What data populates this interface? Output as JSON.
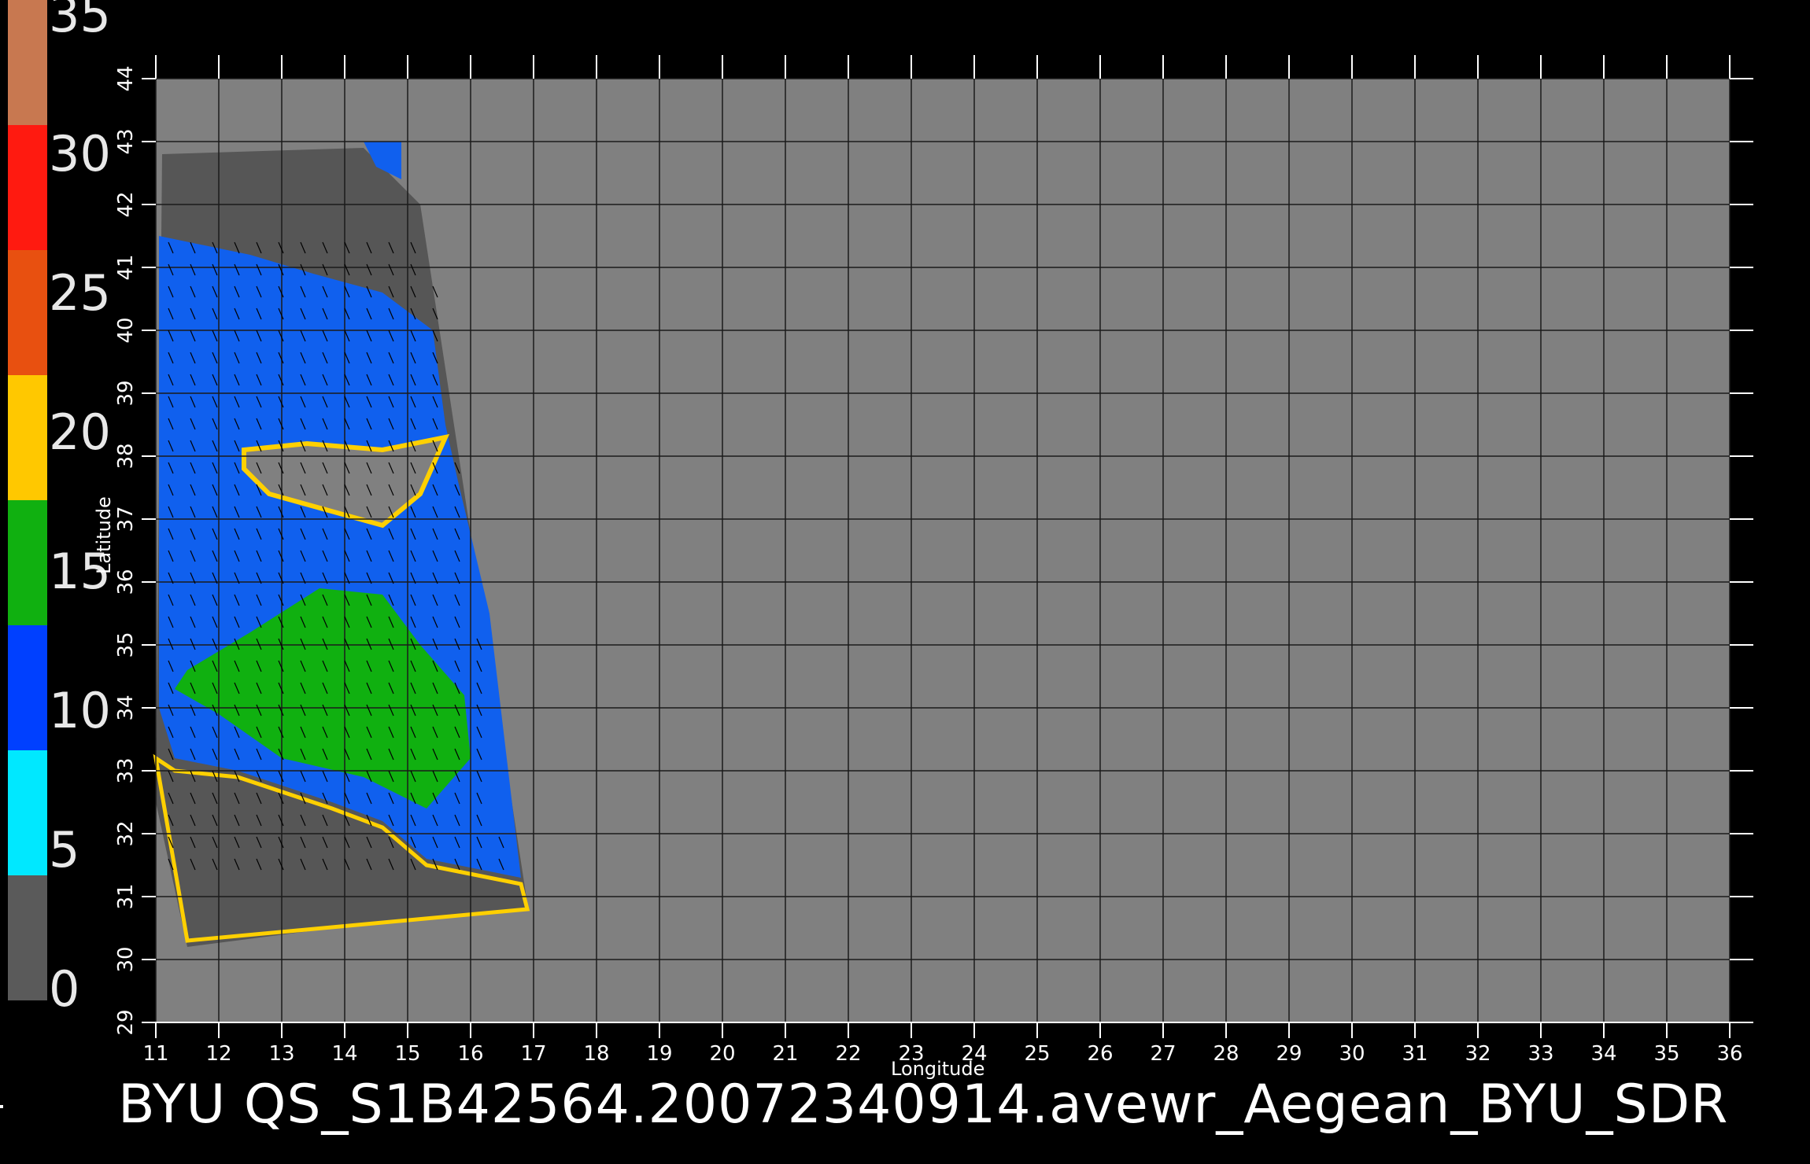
{
  "colorbar": {
    "labels": [
      "35",
      "30",
      "25",
      "20",
      "15",
      "10",
      "5",
      "0"
    ],
    "segments": [
      {
        "color": "#c87850"
      },
      {
        "color": "#ff1a10"
      },
      {
        "color": "#e85010"
      },
      {
        "color": "#ffc800"
      },
      {
        "color": "#10b010"
      },
      {
        "color": "#0040ff"
      },
      {
        "color": "#00e8ff"
      },
      {
        "color": "#5a5a5a"
      }
    ]
  },
  "axes": {
    "x_title": "Longitude",
    "y_title": "Latitude",
    "x_ticks": [
      "11",
      "12",
      "13",
      "14",
      "15",
      "16",
      "17",
      "18",
      "19",
      "20",
      "21",
      "22",
      "23",
      "24",
      "25",
      "26",
      "27",
      "28",
      "29",
      "30",
      "31",
      "32",
      "33",
      "34",
      "35",
      "36"
    ],
    "y_ticks": [
      "29",
      "30",
      "31",
      "32",
      "33",
      "34",
      "35",
      "36",
      "37",
      "38",
      "39",
      "40",
      "41",
      "42",
      "43",
      "44"
    ]
  },
  "caption": "BYU  QS_S1B42564.20072340914.avewr_Aegean_BYU_SDR",
  "colors": {
    "background": "#000000",
    "land_gray": "#808080",
    "swath_gray": "#565656",
    "grid": "#1a1a1a"
  }
}
